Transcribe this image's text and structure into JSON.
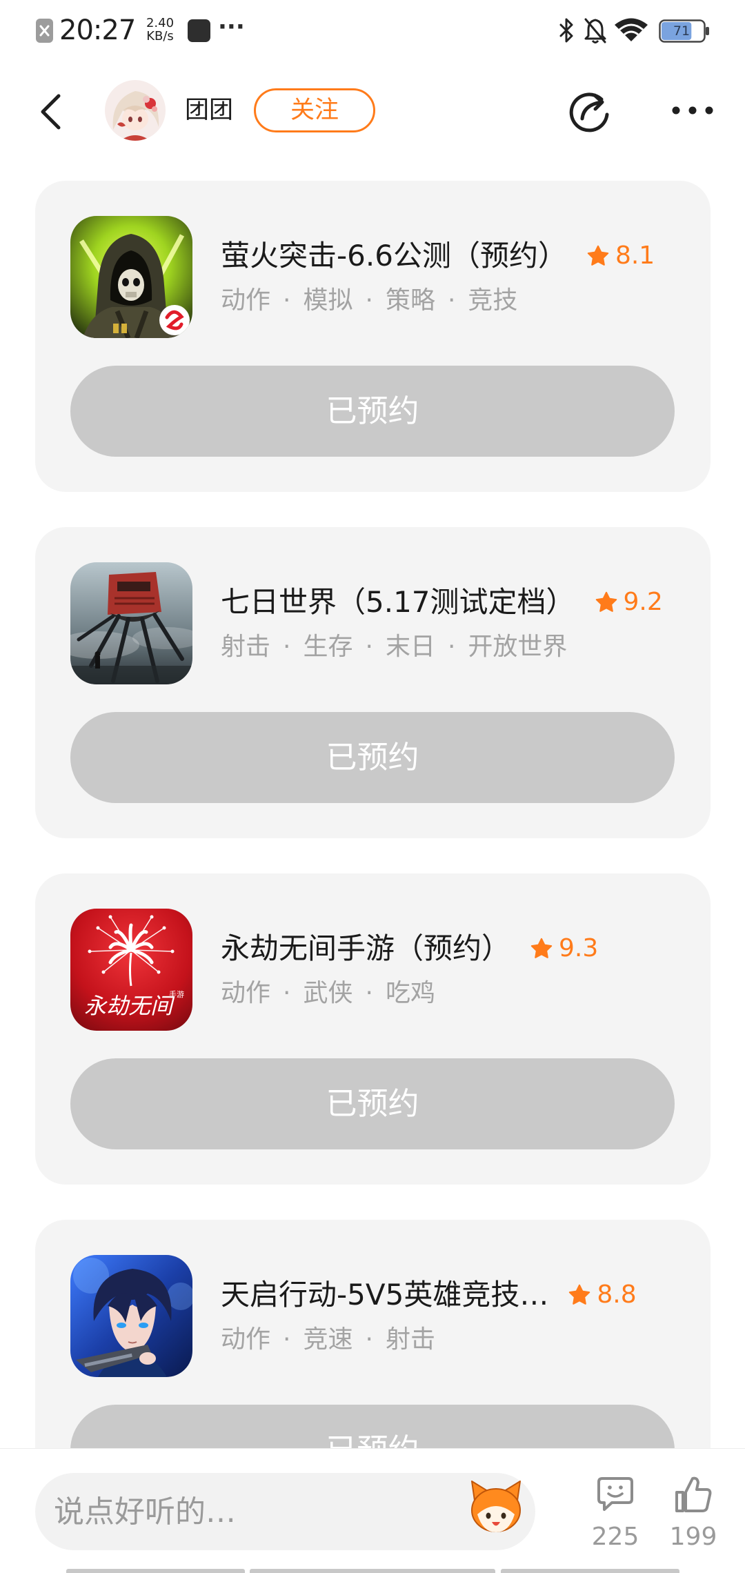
{
  "status_bar": {
    "time": "20:27",
    "net_speed": {
      "value": "2.40",
      "unit": "KB/s"
    },
    "more_notifications": "···",
    "battery_level": "71",
    "icons": [
      "notification-icon",
      "app-notification-icon",
      "bluetooth-icon",
      "bell-muted-icon",
      "wifi-icon",
      "battery-icon"
    ]
  },
  "header": {
    "username": "团团",
    "follow_label": "关注",
    "icons": [
      "back-arrow-icon",
      "avatar",
      "share-icon",
      "more-icon"
    ]
  },
  "tag_separator": "·",
  "games": [
    {
      "title": "萤火突击-6.6公测（预约）",
      "rating": "8.1",
      "tags": [
        "动作",
        "模拟",
        "策略",
        "竞技"
      ],
      "button_label": "已预约",
      "icon": "hooded-skull-soldier-icon"
    },
    {
      "title": "七日世界（5.17测试定档）",
      "rating": "9.2",
      "tags": [
        "射击",
        "生存",
        "末日",
        "开放世界"
      ],
      "button_label": "已预约",
      "icon": "red-train-creature-icon"
    },
    {
      "title": "永劫无间手游（预约）",
      "rating": "9.3",
      "tags": [
        "动作",
        "武侠",
        "吃鸡"
      ],
      "button_label": "已预约",
      "icon": "spider-lily-icon",
      "icon_text": "永劫无间",
      "icon_subtext": "手游"
    },
    {
      "title": "天启行动-5V5英雄竞技…",
      "rating": "8.8",
      "tags": [
        "动作",
        "竞速",
        "射击"
      ],
      "button_label": "已预约",
      "icon": "anime-gunner-icon"
    }
  ],
  "comment_bar": {
    "placeholder": "说点好听的…",
    "comment_count": "225",
    "like_count": "199",
    "icons": [
      "mascot-emoji-icon",
      "comment-icon",
      "like-icon"
    ]
  },
  "colors": {
    "accent": "#ff7b1a",
    "card_background": "#f4f4f4",
    "reserved_button": "#c9c9c9",
    "muted_text": "#a3a3a3",
    "icon_gray": "#8c8c8c"
  }
}
